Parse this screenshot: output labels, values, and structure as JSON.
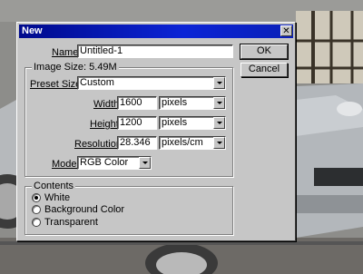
{
  "dialog": {
    "title": "New",
    "close_glyph": "✕",
    "name": {
      "label": "Name:",
      "value": "Untitled-1"
    },
    "ok_label": "OK",
    "cancel_label": "Cancel",
    "image_size": {
      "group_label": "Image Size: 5.49M"
    },
    "preset_sizes": {
      "label": "Preset Sizes:",
      "value": "Custom"
    },
    "width": {
      "label": "Width:",
      "value": "1600",
      "unit": "pixels"
    },
    "height": {
      "label": "Height:",
      "value": "1200",
      "unit": "pixels"
    },
    "resolution": {
      "label": "Resolution:",
      "value": "28.346",
      "unit": "pixels/cm"
    },
    "mode": {
      "label": "Mode:",
      "value": "RGB Color"
    },
    "contents": {
      "group_label": "Contents",
      "options": [
        {
          "label": "White",
          "checked": true
        },
        {
          "label": "Background Color",
          "checked": false
        },
        {
          "label": "Transparent",
          "checked": false
        }
      ]
    }
  },
  "colors": {
    "title_bar": "#0b24d6",
    "dialog_face": "#c6c6c6"
  }
}
